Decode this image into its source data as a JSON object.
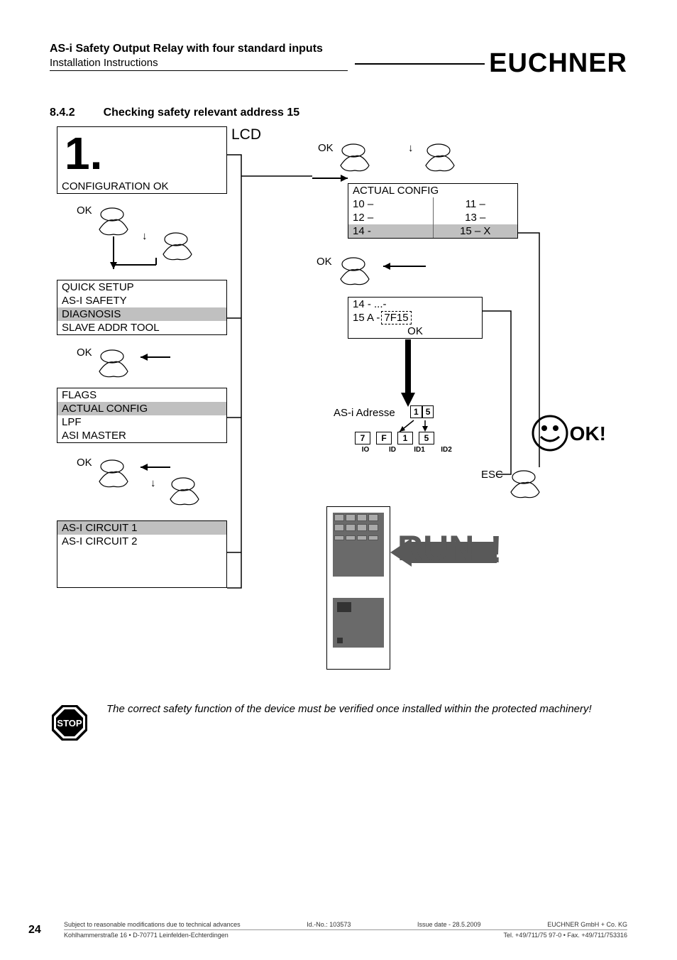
{
  "header": {
    "title": "AS-i Safety Output Relay with four standard inputs",
    "subtitle": "Installation Instructions",
    "brand": "EUCHNER"
  },
  "section": {
    "number": "8.4.2",
    "title": "Checking safety relevant address 15"
  },
  "diagram": {
    "lcd_label": "LCD",
    "step_number": "1.",
    "config_ok": "CONFIGURATION OK",
    "ok": "OK",
    "esc": "ESC",
    "down_arrow": "↓",
    "menu1": {
      "r1": "QUICK SETUP",
      "r2": "AS-I SAFETY",
      "r3": "DIAGNOSIS",
      "r4": "SLAVE ADDR TOOL"
    },
    "menu2": {
      "r1": "FLAGS",
      "r2": "ACTUAL CONFIG",
      "r3": "LPF",
      "r4": "ASI MASTER"
    },
    "menu3": {
      "r1": "AS-I CIRCUIT 1",
      "r2": "AS-I CIRCUIT 2"
    },
    "actual_config": {
      "title": "ACTUAL CONFIG",
      "r1a": "10 –",
      "r1b": "11 –",
      "r2a": "12 –",
      "r2b": "13 –",
      "r3a": "14 -",
      "r3b": "15 – X"
    },
    "detail": {
      "r1": "14  - ...-",
      "r2a": "15 A -",
      "r2b": "7F15",
      "r3": "OK"
    },
    "address_label": "AS-i Adresse",
    "addr_d1": "1",
    "addr_d2": "5",
    "id_codes": {
      "c1": "7",
      "c2": "F",
      "c3": "1",
      "c4": "5",
      "l1": "IO",
      "l2": "ID",
      "l3": "ID1",
      "l4": "ID2"
    },
    "ok_excl": "OK!",
    "run": "RUN",
    "excl": "!"
  },
  "warning": "The correct safety function of the device must be verified once installed within the protected machinery!",
  "footer": {
    "page": "24",
    "left1": "Subject to reasonable modifications due to technical advances",
    "mid1": "Id.-No.: 103573",
    "mid2": "Issue date - 28.5.2009",
    "right1": "EUCHNER GmbH + Co. KG",
    "left2": "Kohlhammerstraße 16 • D-70771 Leinfelden-Echterdingen",
    "right2": "Tel. +49/711/75 97-0 • Fax. +49/711/753316"
  }
}
